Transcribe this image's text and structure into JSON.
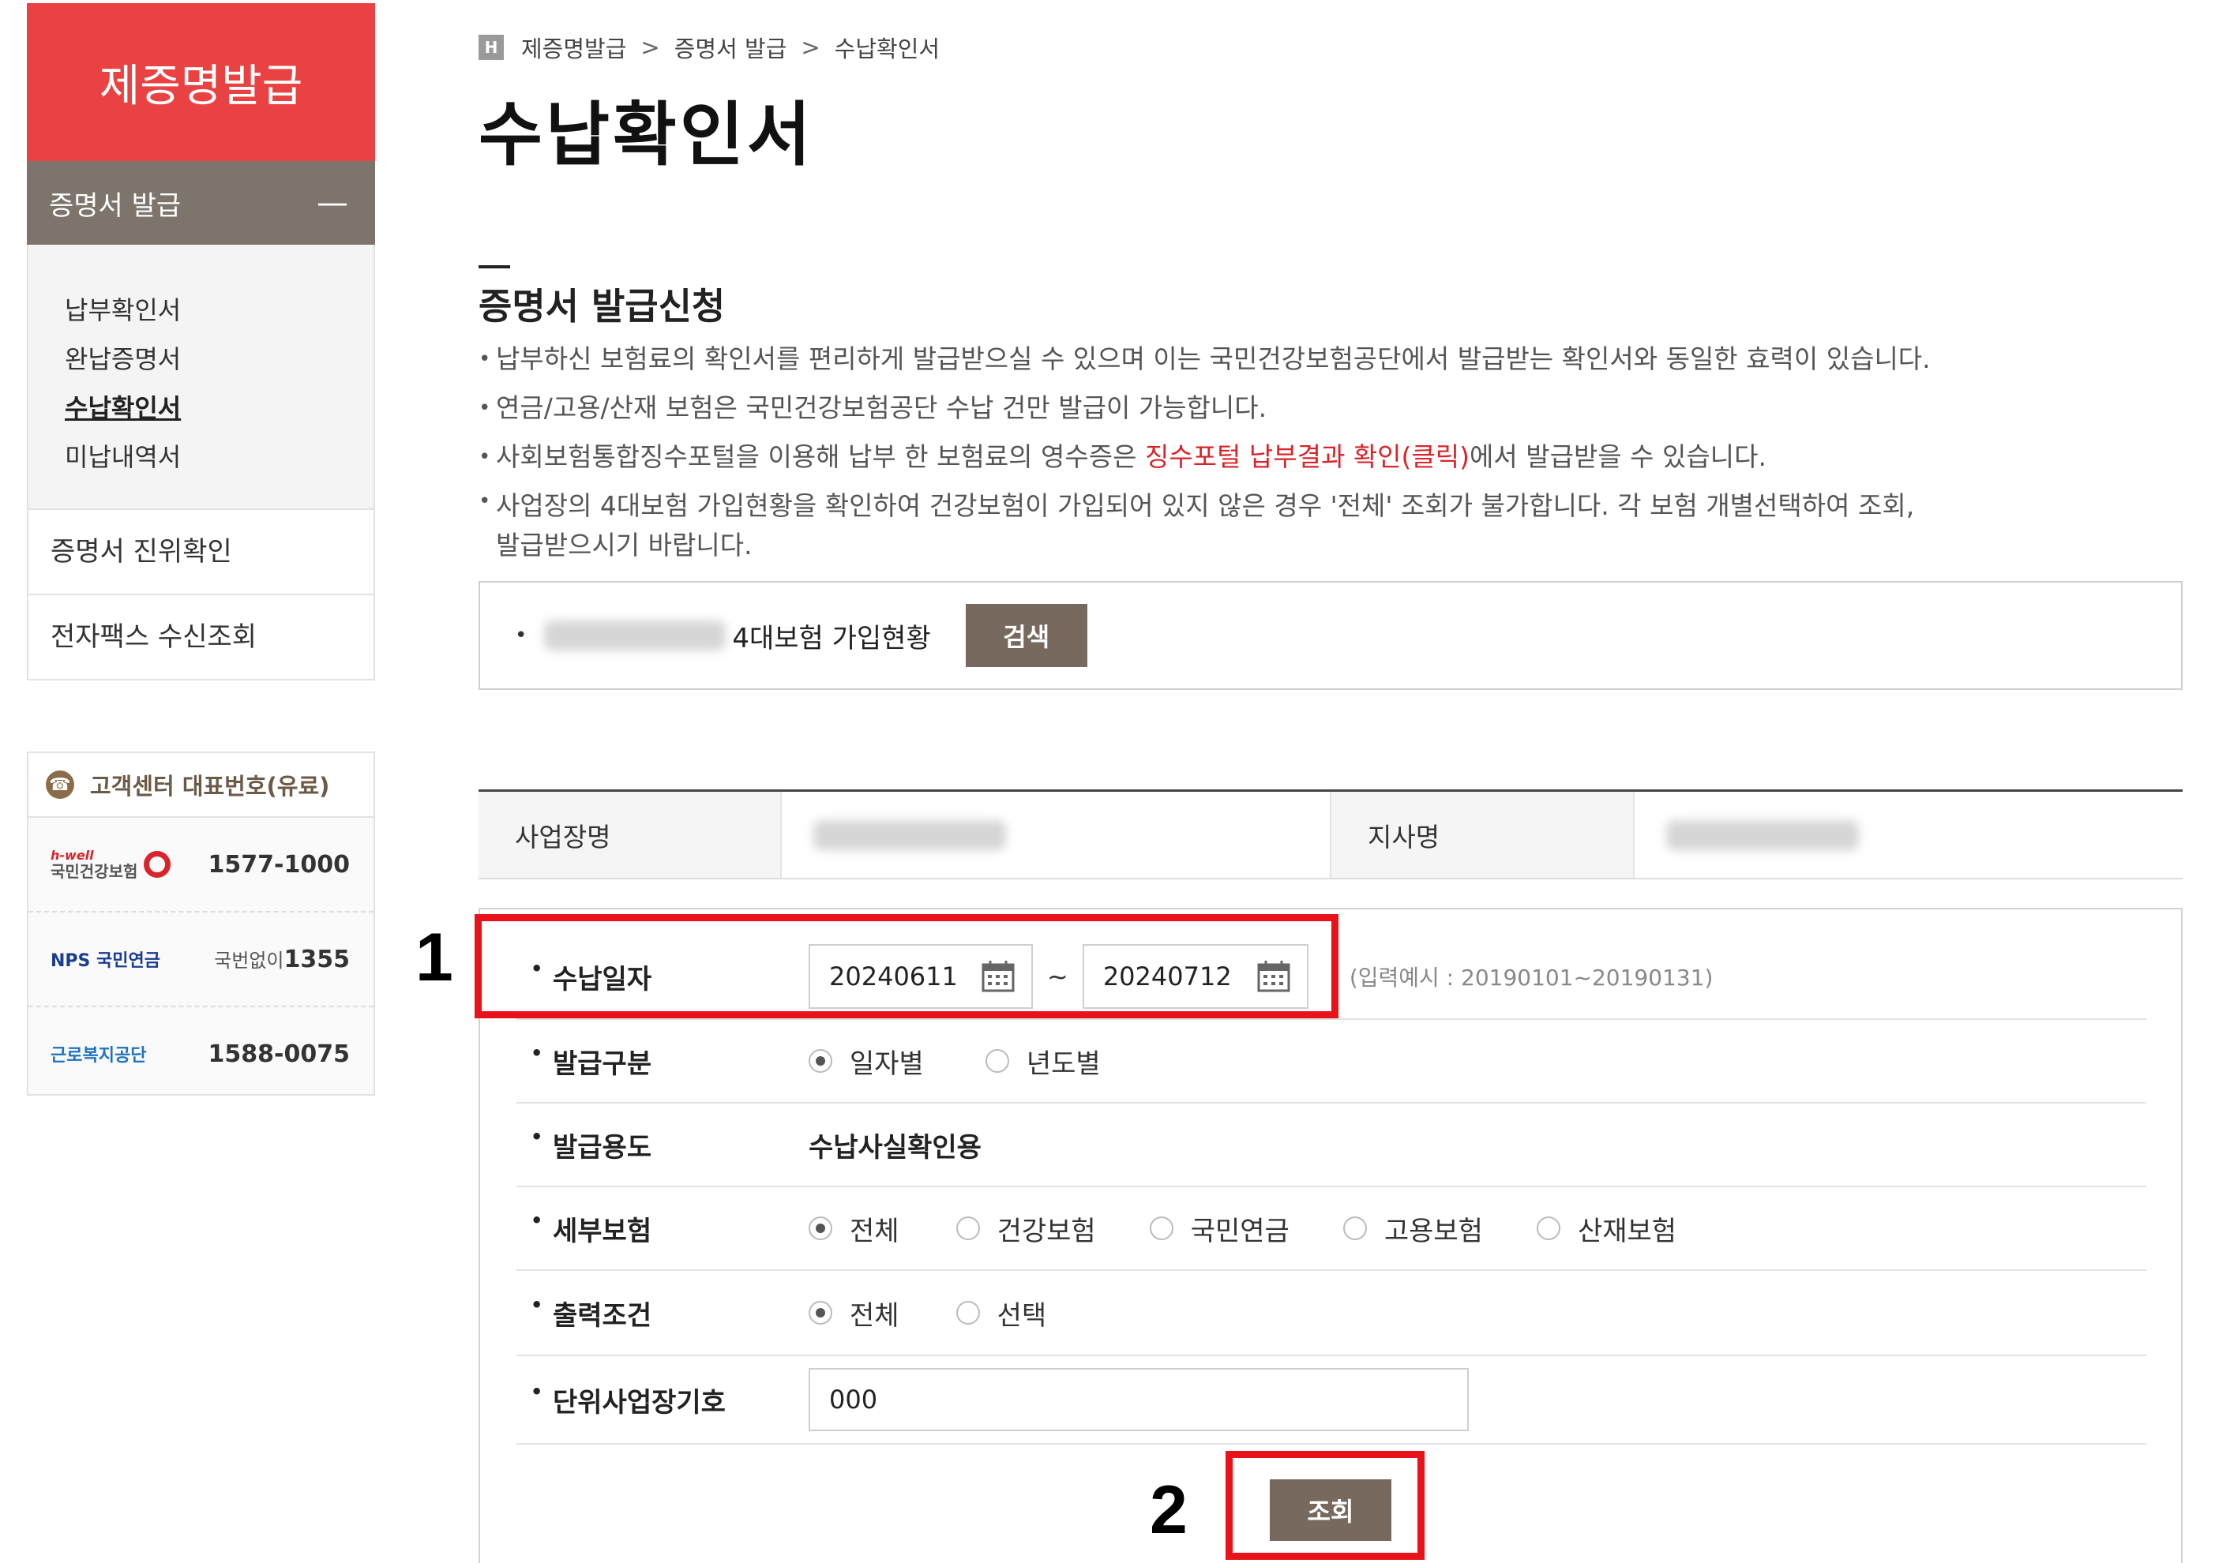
{
  "sidebar": {
    "title": "제증명발급",
    "section": "증명서 발급",
    "collapse_symbol": "—",
    "items": [
      "납부확인서",
      "완납증명서",
      "수납확인서",
      "미납내역서"
    ],
    "menus": [
      "증명서 진위확인",
      "전자팩스 수신조회"
    ]
  },
  "contact": {
    "title": "고객센터 대표번호(유료)",
    "rows": [
      {
        "org": "국민건강보험",
        "org_tag": "h-well",
        "number": "1577-1000",
        "color": "#d8242a"
      },
      {
        "org": "NPS 국민연금",
        "prefix": "국번없이",
        "number": "1355",
        "color": "#1a3d8f"
      },
      {
        "org": "근로복지공단",
        "number": "1588-0075",
        "color": "#1e73be"
      }
    ]
  },
  "breadcrumb": {
    "home": "H",
    "items": [
      "제증명발급",
      "증명서 발급",
      "수납확인서"
    ],
    "sep": ">"
  },
  "page_title": "수납확인서",
  "section_title": "증명서 발급신청",
  "notes": {
    "n1": "납부하신 보험료의 확인서를 편리하게 발급받으실 수 있으며 이는 국민건강보험공단에서 발급받는 확인서와 동일한 효력이 있습니다.",
    "n2": "연금/고용/산재 보험은 국민건강보험공단 수납 건만 발급이 가능합니다.",
    "n3_pre": "사회보험통합징수포털을 이용해 납부 한 보험료의 영수증은 ",
    "n3_link": "징수포털 납부결과 확인(클릭)",
    "n3_post": "에서 발급받을 수 있습니다.",
    "n4a": "사업장의 4대보험 가입현황을 확인하여 건강보험이 가입되어 있지 않은 경우 '전체' 조회가 불가합니다. 각 보험 개별선택하여 조회,",
    "n4b": "발급받으시기 바랍니다."
  },
  "search": {
    "label": "4대보험 가입현황",
    "button": "검색"
  },
  "info": {
    "business_name_label": "사업장명",
    "branch_label": "지사명"
  },
  "form": {
    "payment_date": {
      "label": "수납일자",
      "from": "20240611",
      "to": "20240712",
      "tilde": "~",
      "hint": "(입력예시 : 20190101~20190131)"
    },
    "issue_type": {
      "label": "발급구분",
      "options": [
        "일자별",
        "년도별"
      ],
      "selected": "일자별"
    },
    "purpose": {
      "label": "발급용도",
      "value": "수납사실확인용"
    },
    "insurance": {
      "label": "세부보험",
      "options": [
        "전체",
        "건강보험",
        "국민연금",
        "고용보험",
        "산재보험"
      ],
      "selected": "전체"
    },
    "output": {
      "label": "출력조건",
      "options": [
        "전체",
        "선택"
      ],
      "selected": "전체"
    },
    "unit_code": {
      "label": "단위사업장기호",
      "value": "000"
    },
    "submit": "조회"
  },
  "markers": {
    "m1": "1",
    "m2": "2"
  }
}
